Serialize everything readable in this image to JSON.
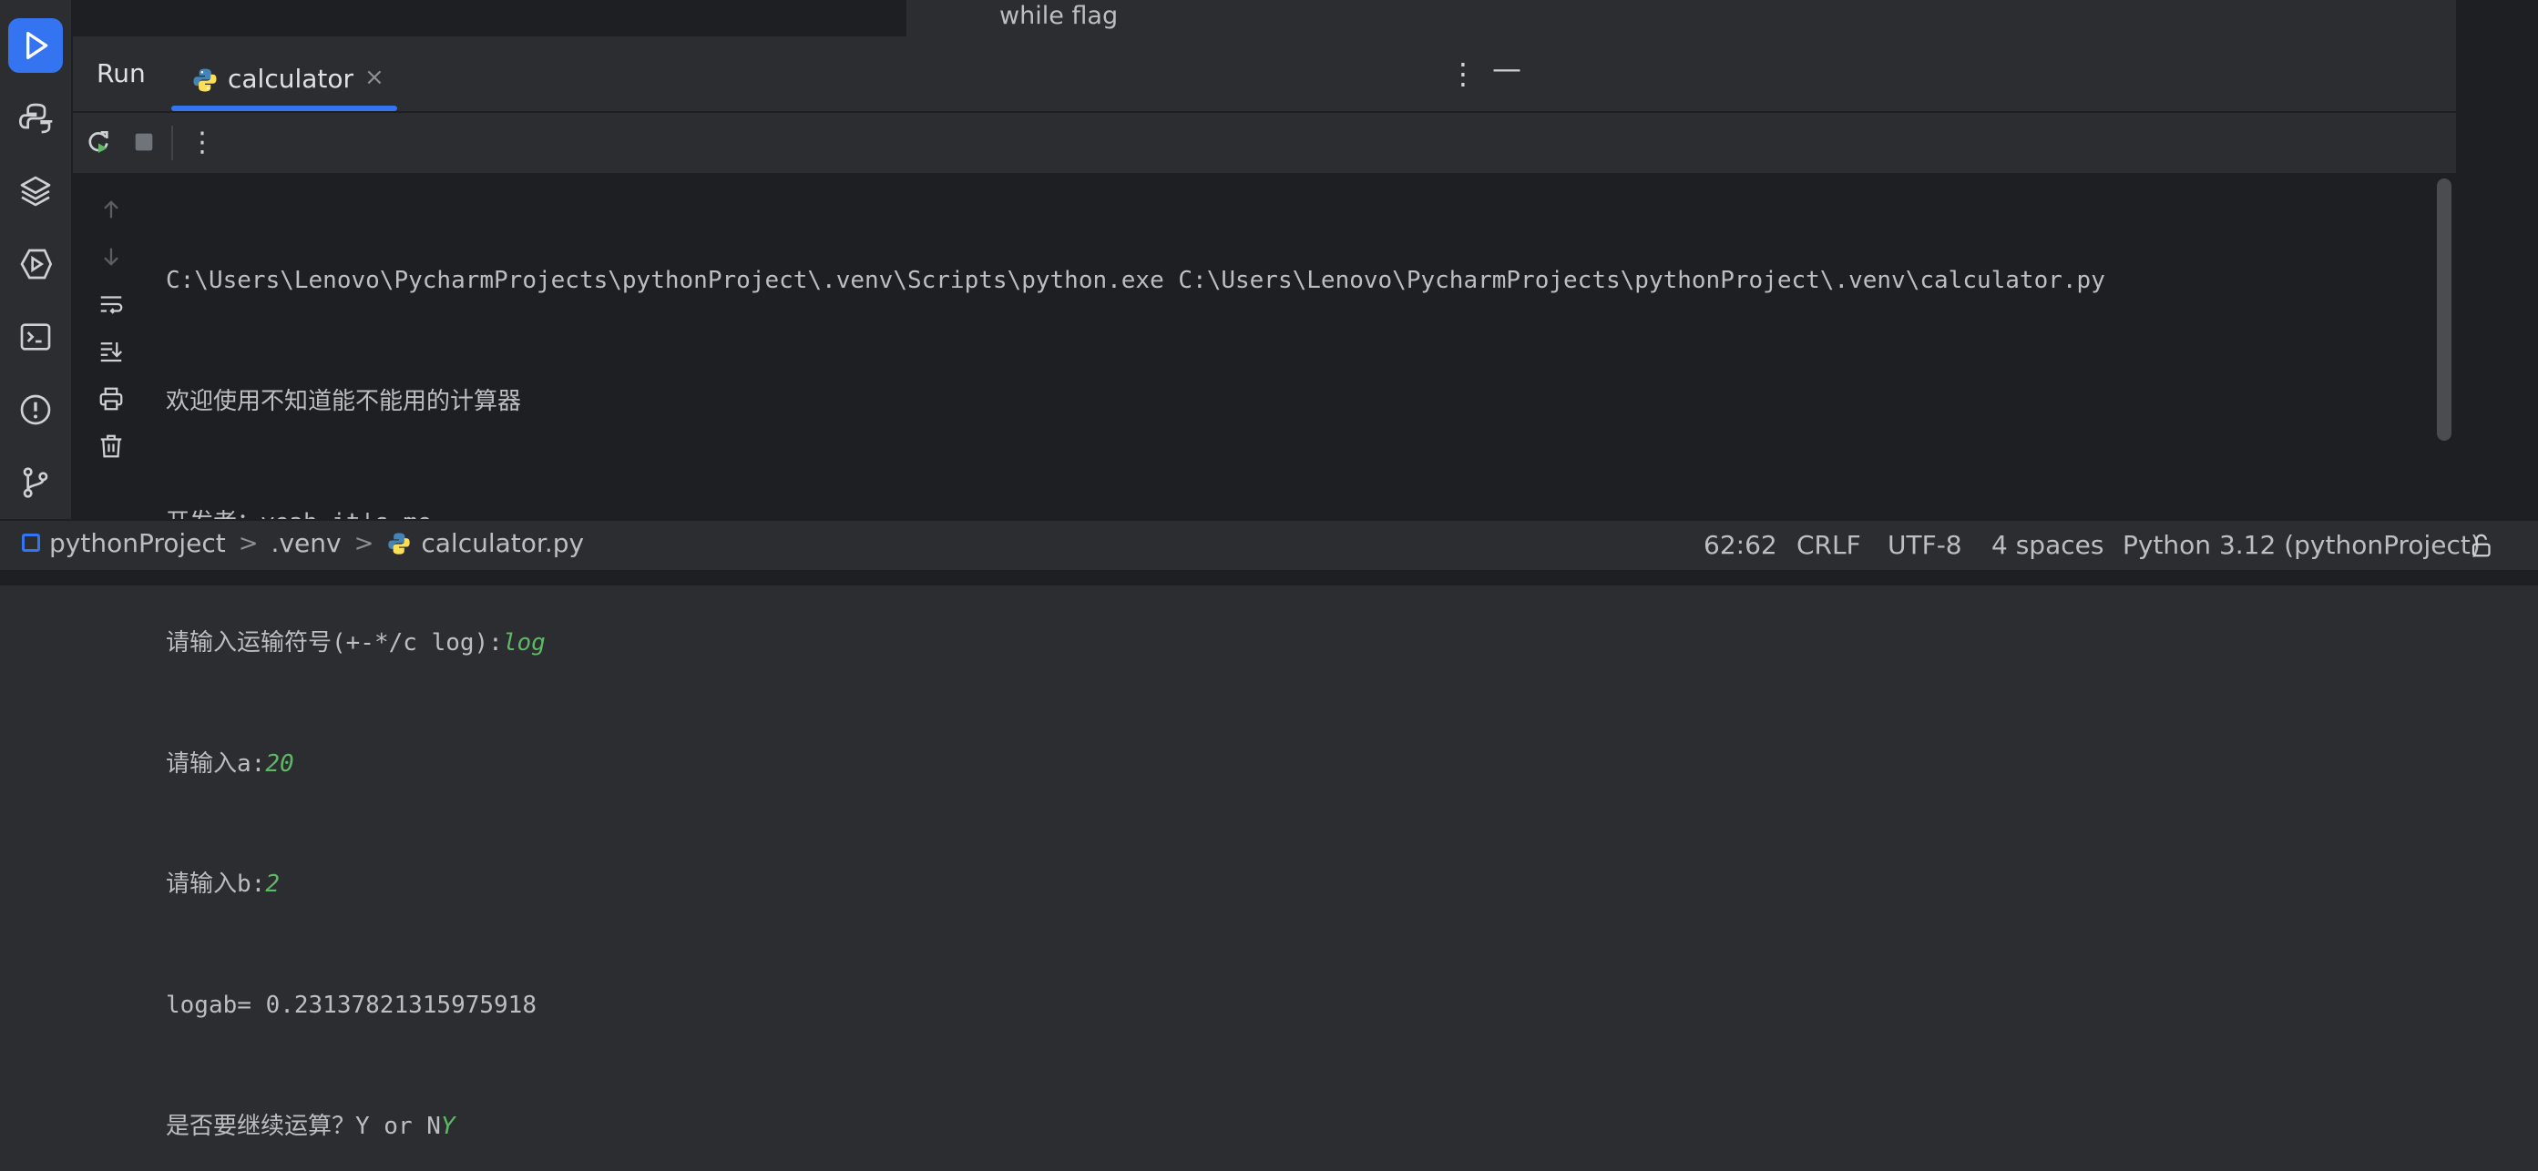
{
  "editor": {
    "hint_text": "while flag"
  },
  "run_window": {
    "title": "Run",
    "tab_label": "calculator",
    "tab_close": "×",
    "more_glyph": "⋮",
    "minimize_glyph": "—"
  },
  "console": {
    "command": "C:\\Users\\Lenovo\\PycharmProjects\\pythonProject\\.venv\\Scripts\\python.exe C:\\Users\\Lenovo\\PycharmProjects\\pythonProject\\.venv\\calculator.py",
    "welcome": "欢迎使用不知道能不能用的计算器",
    "developer": "开发者：yeah it's me",
    "op_prompt": "请输入运输符号(+-*/c log):",
    "op_input": "log",
    "a_prompt": "请输入a:",
    "a_input": "20",
    "b_prompt": "请输入b:",
    "b_input": "2",
    "result": "logab= 0.23137821315975918",
    "continue_prompt": "是否要继续运算？Y or N",
    "continue_input": "Y"
  },
  "status_bar": {
    "project": "pythonProject",
    "folder": ".venv",
    "file": "calculator.py",
    "chevron": ">",
    "position": "62:62",
    "line_sep": "CRLF",
    "encoding": "UTF-8",
    "indent": "4 spaces",
    "interpreter": "Python 3.12 (pythonProject)"
  },
  "colors": {
    "accent": "#3574f0",
    "input_echo": "#5fb865",
    "console_bg": "#1e1f22",
    "panel_bg": "#2b2d30"
  },
  "icons": {
    "toolstrip": [
      "run-icon",
      "python-console-icon",
      "layers-icon",
      "services-icon",
      "terminal-icon",
      "problems-icon",
      "git-icon"
    ],
    "actions": [
      "rerun-icon",
      "stop-icon",
      "more-actions-icon"
    ],
    "side": [
      "scroll-up-icon",
      "scroll-down-icon",
      "soft-wrap-icon",
      "scroll-to-end-icon",
      "print-icon",
      "clear-icon"
    ]
  }
}
